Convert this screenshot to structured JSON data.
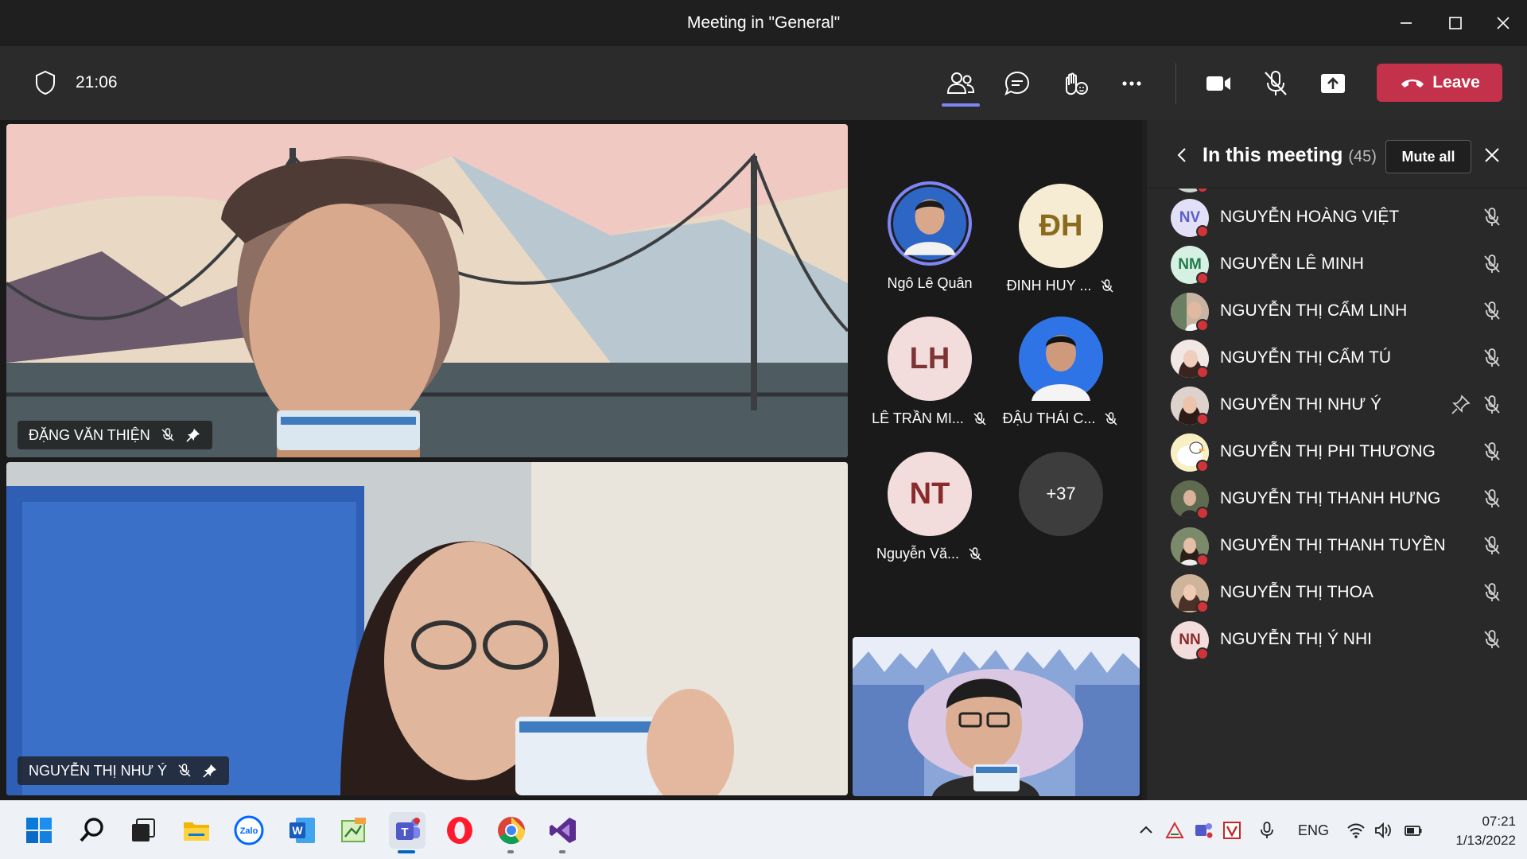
{
  "window": {
    "title": "Meeting in \"General\"",
    "controls": [
      "minimize-icon",
      "maximize-icon",
      "close-icon"
    ]
  },
  "toolbar": {
    "timer": "21:06",
    "icons": [
      "shield-icon",
      "people-icon",
      "chat-icon",
      "reactions-icon",
      "more-icon",
      "camera-icon",
      "mic-off-icon",
      "share-icon"
    ],
    "leave_label": "Leave",
    "accent": "#7f85f5",
    "leave_color": "#c4314b"
  },
  "stage": {
    "videos": [
      {
        "name": "ĐẶNG VĂN THIỆN",
        "muted": true,
        "pinned": true
      },
      {
        "name": "NGUYỄN THỊ NHƯ Ý",
        "muted": true,
        "pinned": true
      }
    ],
    "gallery": [
      {
        "label": "Ngô Lê Quân",
        "kind": "photo",
        "muted": false,
        "speaking": true
      },
      {
        "label": "ĐINH HUY ...",
        "initials": "ĐH",
        "bg": "#f6ecd4",
        "fg": "#8a6a1c",
        "muted": true
      },
      {
        "label": "LÊ TRẦN MI...",
        "initials": "LH",
        "bg": "#f3dcdc",
        "fg": "#7e3434",
        "muted": true
      },
      {
        "label": "ĐẬU THÁI C...",
        "kind": "photo",
        "muted": true
      },
      {
        "label": "Nguyễn Vă...",
        "initials": "NT",
        "bg": "#f3dcdc",
        "fg": "#8a2b2b",
        "muted": true
      },
      {
        "overflow": "+37"
      }
    ]
  },
  "panel": {
    "title": "In this meeting",
    "count": "(45)",
    "mute_all_label": "Mute all",
    "participants": [
      {
        "name": "NGUYỄN HOÀNG VIỆT",
        "initials": "NV",
        "bg": "#e2e0f6",
        "fg": "#5b5fc7",
        "pinned": false
      },
      {
        "name": "NGUYỄN LÊ MINH",
        "initials": "NM",
        "bg": "#d6f0e4",
        "fg": "#237b4b",
        "pinned": false
      },
      {
        "name": "NGUYỄN THỊ CẨM LINH",
        "photo": true,
        "pinned": false
      },
      {
        "name": "NGUYỄN THỊ CẨM TÚ",
        "photo": true,
        "pinned": false
      },
      {
        "name": "NGUYỄN THỊ NHƯ Ý",
        "photo": true,
        "pinned": true
      },
      {
        "name": "NGUYỄN THỊ PHI THƯƠNG",
        "photo": true,
        "pinned": false
      },
      {
        "name": "NGUYỄN THỊ THANH HƯNG",
        "photo": true,
        "pinned": false
      },
      {
        "name": "NGUYỄN THỊ THANH TUYỀN",
        "photo": true,
        "pinned": false
      },
      {
        "name": "NGUYỄN THỊ THOA",
        "photo": true,
        "pinned": false
      },
      {
        "name": "NGUYỄN THỊ Ý NHI",
        "initials": "NN",
        "bg": "#f3dcdc",
        "fg": "#8a2b2b",
        "pinned": false
      }
    ]
  },
  "taskbar": {
    "apps": [
      "start-icon",
      "search-icon",
      "task-view-icon",
      "file-explorer-icon",
      "zalo-icon",
      "word-icon",
      "paint-icon",
      "teams-icon",
      "opera-icon",
      "chrome-icon",
      "visual-studio-icon"
    ],
    "zalo_label": "Zalo",
    "word_label": "W",
    "tray_language": "ENG",
    "time": "07:21",
    "date": "1/13/2022"
  }
}
